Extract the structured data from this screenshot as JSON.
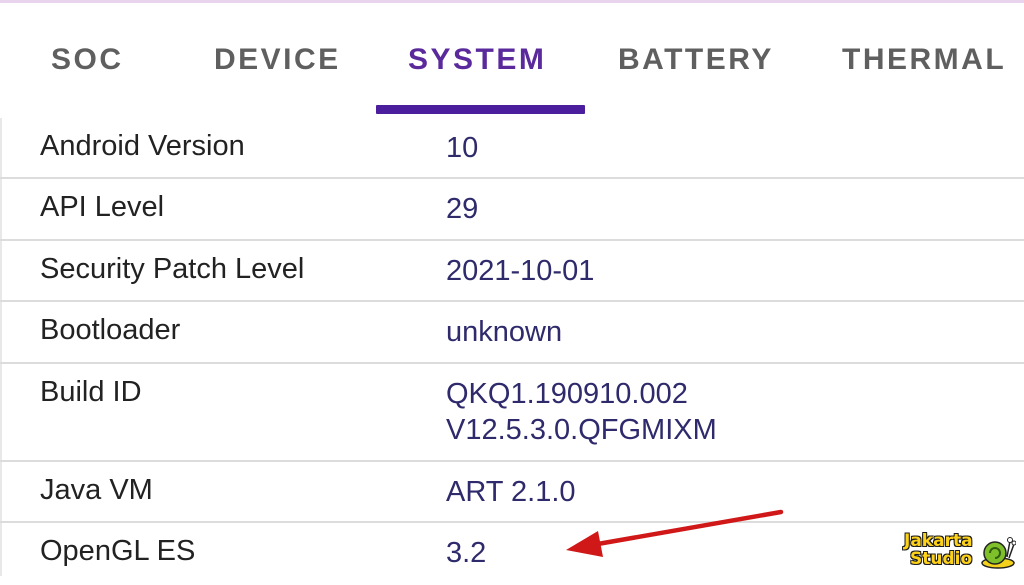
{
  "tabs": [
    {
      "label": "SOC"
    },
    {
      "label": "DEVICE"
    },
    {
      "label": "SYSTEM"
    },
    {
      "label": "BATTERY"
    },
    {
      "label": "THERMAL"
    }
  ],
  "active_tab": "SYSTEM",
  "rows": [
    {
      "label": "Android Version",
      "value": "10"
    },
    {
      "label": "API Level",
      "value": "29"
    },
    {
      "label": "Security Patch Level",
      "value": "2021-10-01"
    },
    {
      "label": "Bootloader",
      "value": "unknown"
    },
    {
      "label": "Build ID",
      "value": "QKQ1.190910.002",
      "value2": "V12.5.3.0.QFGMIXM"
    },
    {
      "label": "Java VM",
      "value": "ART 2.1.0"
    },
    {
      "label": "OpenGL ES",
      "value": "3.2"
    }
  ],
  "watermark": {
    "line1": "Jakarta",
    "line2": "Studio"
  },
  "colors": {
    "accent": "#4b1e9e",
    "active_tab_text": "#5a2a9c",
    "value_text": "#2e2a6b",
    "annotation_arrow": "#d01818"
  }
}
